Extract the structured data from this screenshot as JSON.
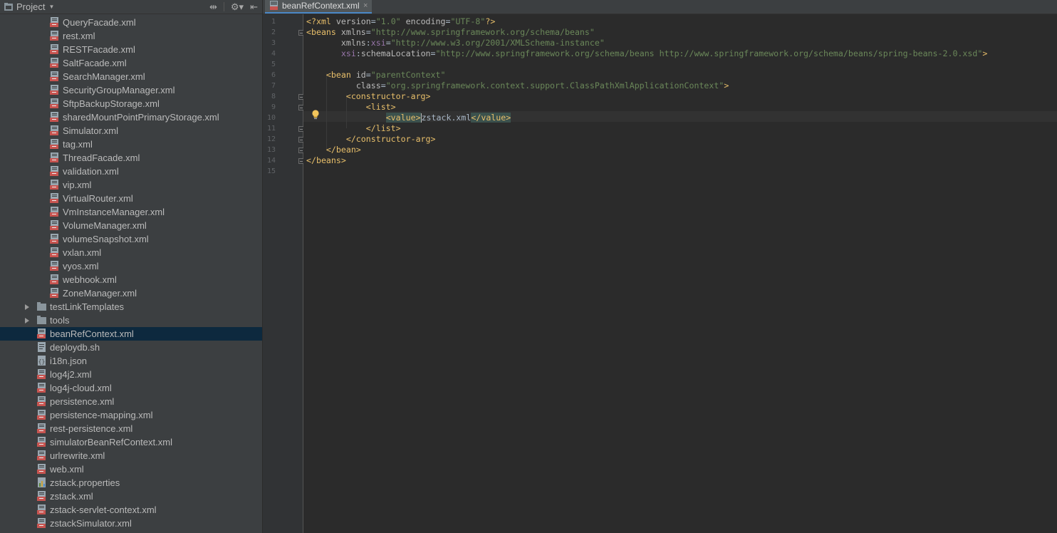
{
  "sidebar": {
    "title": "Project",
    "items": [
      {
        "label": "QueryFacade.xml",
        "type": "xml",
        "level": 2
      },
      {
        "label": "rest.xml",
        "type": "xml",
        "level": 2
      },
      {
        "label": "RESTFacade.xml",
        "type": "xml",
        "level": 2
      },
      {
        "label": "SaltFacade.xml",
        "type": "xml",
        "level": 2
      },
      {
        "label": "SearchManager.xml",
        "type": "xml",
        "level": 2
      },
      {
        "label": "SecurityGroupManager.xml",
        "type": "xml",
        "level": 2
      },
      {
        "label": "SftpBackupStorage.xml",
        "type": "xml",
        "level": 2
      },
      {
        "label": "sharedMountPointPrimaryStorage.xml",
        "type": "xml",
        "level": 2
      },
      {
        "label": "Simulator.xml",
        "type": "xml",
        "level": 2
      },
      {
        "label": "tag.xml",
        "type": "xml",
        "level": 2
      },
      {
        "label": "ThreadFacade.xml",
        "type": "xml",
        "level": 2
      },
      {
        "label": "validation.xml",
        "type": "xml",
        "level": 2
      },
      {
        "label": "vip.xml",
        "type": "xml",
        "level": 2
      },
      {
        "label": "VirtualRouter.xml",
        "type": "xml",
        "level": 2
      },
      {
        "label": "VmInstanceManager.xml",
        "type": "xml",
        "level": 2
      },
      {
        "label": "VolumeManager.xml",
        "type": "xml",
        "level": 2
      },
      {
        "label": "volumeSnapshot.xml",
        "type": "xml",
        "level": 2
      },
      {
        "label": "vxlan.xml",
        "type": "xml",
        "level": 2
      },
      {
        "label": "vyos.xml",
        "type": "xml",
        "level": 2
      },
      {
        "label": "webhook.xml",
        "type": "xml",
        "level": 2
      },
      {
        "label": "ZoneManager.xml",
        "type": "xml",
        "level": 2
      },
      {
        "label": "testLinkTemplates",
        "type": "folder",
        "level": 1
      },
      {
        "label": "tools",
        "type": "folder",
        "level": 1
      },
      {
        "label": "beanRefContext.xml",
        "type": "xml",
        "level": 1,
        "selected": true
      },
      {
        "label": "deploydb.sh",
        "type": "sh",
        "level": 1
      },
      {
        "label": "i18n.json",
        "type": "json",
        "level": 1
      },
      {
        "label": "log4j2.xml",
        "type": "xml",
        "level": 1
      },
      {
        "label": "log4j-cloud.xml",
        "type": "xml",
        "level": 1
      },
      {
        "label": "persistence.xml",
        "type": "xml",
        "level": 1
      },
      {
        "label": "persistence-mapping.xml",
        "type": "xml",
        "level": 1
      },
      {
        "label": "rest-persistence.xml",
        "type": "xml",
        "level": 1
      },
      {
        "label": "simulatorBeanRefContext.xml",
        "type": "xml",
        "level": 1
      },
      {
        "label": "urlrewrite.xml",
        "type": "xml",
        "level": 1
      },
      {
        "label": "web.xml",
        "type": "xml",
        "level": 1
      },
      {
        "label": "zstack.properties",
        "type": "properties",
        "level": 1
      },
      {
        "label": "zstack.xml",
        "type": "xml",
        "level": 1
      },
      {
        "label": "zstack-servlet-context.xml",
        "type": "xml",
        "level": 1
      },
      {
        "label": "zstackSimulator.xml",
        "type": "xml",
        "level": 1
      }
    ]
  },
  "editor": {
    "tab_label": "beanRefContext.xml",
    "line_numbers": [
      "1",
      "2",
      "3",
      "4",
      "5",
      "6",
      "7",
      "8",
      "9",
      "10",
      "11",
      "12",
      "13",
      "14",
      "15"
    ],
    "caret_line": 10,
    "code": [
      [
        [
          "t",
          "<?xml "
        ],
        [
          "a",
          "version"
        ],
        [
          "x",
          "="
        ],
        [
          "v",
          "\"1.0\""
        ],
        [
          "x",
          " "
        ],
        [
          "a",
          "encoding"
        ],
        [
          "x",
          "="
        ],
        [
          "v",
          "\"UTF-8\""
        ],
        [
          "t",
          "?>"
        ]
      ],
      [
        [
          "t",
          "<beans "
        ],
        [
          "a",
          "xmlns"
        ],
        [
          "x",
          "="
        ],
        [
          "v",
          "\"http://www.springframework.org/schema/beans\""
        ]
      ],
      [
        [
          "x",
          "       "
        ],
        [
          "a",
          "xmlns"
        ],
        [
          "x",
          ":"
        ],
        [
          "ns",
          "xsi"
        ],
        [
          "x",
          "="
        ],
        [
          "v",
          "\"http://www.w3.org/2001/XMLSchema-instance\""
        ]
      ],
      [
        [
          "x",
          "       "
        ],
        [
          "ns",
          "xsi"
        ],
        [
          "x",
          ":"
        ],
        [
          "a",
          "schemaLocation"
        ],
        [
          "x",
          "="
        ],
        [
          "v",
          "\"http://www.springframework.org/schema/beans http://www.springframework.org/schema/beans/spring-beans-2.0.xsd\""
        ],
        [
          "t",
          ">"
        ]
      ],
      [],
      [
        [
          "x",
          "    "
        ],
        [
          "t",
          "<bean "
        ],
        [
          "a",
          "id"
        ],
        [
          "x",
          "="
        ],
        [
          "v",
          "\"parentContext\""
        ]
      ],
      [
        [
          "x",
          "          "
        ],
        [
          "a",
          "class"
        ],
        [
          "x",
          "="
        ],
        [
          "v",
          "\"org.springframework.context.support.ClassPathXmlApplicationContext\""
        ],
        [
          "t",
          ">"
        ]
      ],
      [
        [
          "x",
          "        "
        ],
        [
          "t",
          "<constructor-arg>"
        ]
      ],
      [
        [
          "x",
          "            "
        ],
        [
          "t",
          "<list>"
        ]
      ],
      [
        [
          "x",
          "                "
        ],
        [
          "t",
          "<value>",
          "hl"
        ],
        [
          "caret",
          ""
        ],
        [
          "x",
          "zstack.xml"
        ],
        [
          "t",
          "</value>",
          "hl"
        ]
      ],
      [
        [
          "x",
          "            "
        ],
        [
          "t",
          "</list>"
        ]
      ],
      [
        [
          "x",
          "        "
        ],
        [
          "t",
          "</constructor-arg>"
        ]
      ],
      [
        [
          "x",
          "    "
        ],
        [
          "t",
          "</bean>"
        ]
      ],
      [
        [
          "t",
          "</beans>"
        ]
      ],
      []
    ]
  },
  "icons": {
    "project": "project-folder-icon",
    "xml_file": "xml-file-icon",
    "folder": "folder-icon",
    "bulb": "intention-bulb-icon"
  },
  "colors": {
    "sidebar_bg": "#3c3f41",
    "editor_bg": "#2b2b2b",
    "selection": "#0d293e",
    "tag": "#e8bf6a",
    "string": "#6a8759",
    "namespace": "#9876aa"
  }
}
